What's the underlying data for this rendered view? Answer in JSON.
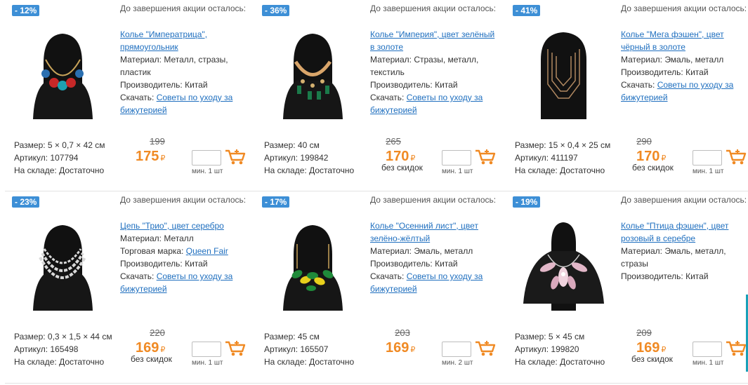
{
  "promo_text": "До завершения акции осталось:",
  "labels": {
    "material": "Материал:",
    "maker": "Производитель:",
    "download": "Скачать:",
    "brand": "Торговая марка:",
    "size": "Размер:",
    "article": "Артикул:",
    "stock": "На складе:",
    "no_discounts": "без скидок",
    "currency": "₽"
  },
  "products": [
    {
      "discount": "- 12%",
      "name_line1": "Колье \"Императрица\",",
      "name_line2": "прямоугольник",
      "material_line1": "Металл, стразы,",
      "material_line2": "пластик",
      "brand": "",
      "maker": "Китай",
      "care_line1": "Советы по уходу за",
      "care_line2": "бижутерией",
      "size": "5 × 0,7 × 42 см",
      "article": "107794",
      "stock": "Достаточно",
      "old_price": "199",
      "price": "175",
      "no_discount": "",
      "min_qty": "мин. 1 шт"
    },
    {
      "discount": "- 36%",
      "name_line1": "Колье \"Империя\", цвет зелёный",
      "name_line2": "в золоте",
      "material_line1": "Стразы, металл,",
      "material_line2": "текстиль",
      "brand": "",
      "maker": "Китай",
      "care_line1": "Советы по уходу за",
      "care_line2": "бижутерией",
      "size": "40 см",
      "article": "199842",
      "stock": "Достаточно",
      "old_price": "265",
      "price": "170",
      "no_discount": "без скидок",
      "min_qty": "мин. 1 шт"
    },
    {
      "discount": "- 41%",
      "name_line1": "Колье \"Мега фэшен\", цвет",
      "name_line2": "чёрный в золоте",
      "material_line1": "Эмаль, металл",
      "material_line2": "",
      "brand": "",
      "maker": "Китай",
      "care_line1": "Советы по уходу за",
      "care_line2": "бижутерией",
      "size": "15 × 0,4 × 25 см",
      "article": "411197",
      "stock": "Достаточно",
      "old_price": "290",
      "price": "170",
      "no_discount": "без скидок",
      "min_qty": "мин. 1 шт"
    },
    {
      "discount": "- 23%",
      "name_line1": "Цепь \"Трио\", цвет серебро",
      "name_line2": "",
      "material_line1": "Металл",
      "material_line2": "",
      "brand": "Queen Fair",
      "maker": "Китай",
      "care_line1": "Советы по уходу за",
      "care_line2": "бижутерией",
      "size": "0,3 × 1,5 × 44 см",
      "article": "165498",
      "stock": "Достаточно",
      "old_price": "220",
      "price": "169",
      "no_discount": "без скидок",
      "min_qty": "мин. 1 шт"
    },
    {
      "discount": "- 17%",
      "name_line1": "Колье \"Осенний лист\", цвет",
      "name_line2": "зелёно-жёлтый",
      "material_line1": "Эмаль, металл",
      "material_line2": "",
      "brand": "",
      "maker": "Китай",
      "care_line1": "Советы по уходу за",
      "care_line2": "бижутерией",
      "size": "45 см",
      "article": "165507",
      "stock": "Достаточно",
      "old_price": "203",
      "price": "169",
      "no_discount": "",
      "min_qty": "мин. 2 шт"
    },
    {
      "discount": "- 19%",
      "name_line1": "Колье \"Птица фэшен\", цвет",
      "name_line2": "розовый в серебре",
      "material_line1": "Эмаль, металл,",
      "material_line2": "стразы",
      "brand": "",
      "maker": "Китай",
      "care_line1": "",
      "care_line2": "",
      "size": "5 × 45 см",
      "article": "199820",
      "stock": "Достаточно",
      "old_price": "209",
      "price": "169",
      "no_discount": "без скидок",
      "min_qty": "мин. 1 шт"
    }
  ]
}
